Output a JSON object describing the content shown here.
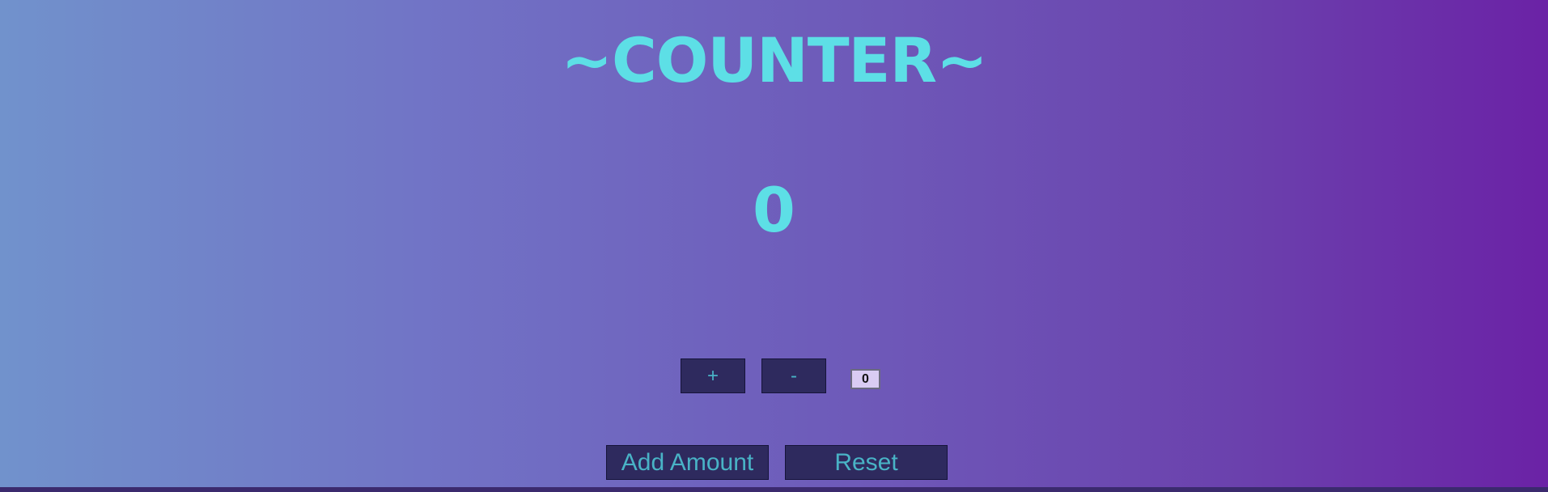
{
  "header": {
    "title": "~COUNTER~"
  },
  "counter": {
    "value": "0"
  },
  "controls": {
    "increment_label": "+",
    "decrement_label": "-",
    "amount_value": "0",
    "add_amount_label": "Add Amount",
    "reset_label": "Reset"
  },
  "colors": {
    "accent": "#5ddfe6",
    "button_bg": "#2e2a5e",
    "button_text": "#49b3c6",
    "input_bg": "#d9ccf3",
    "gradient_start": "#7192cc",
    "gradient_end": "#6b22a6"
  }
}
